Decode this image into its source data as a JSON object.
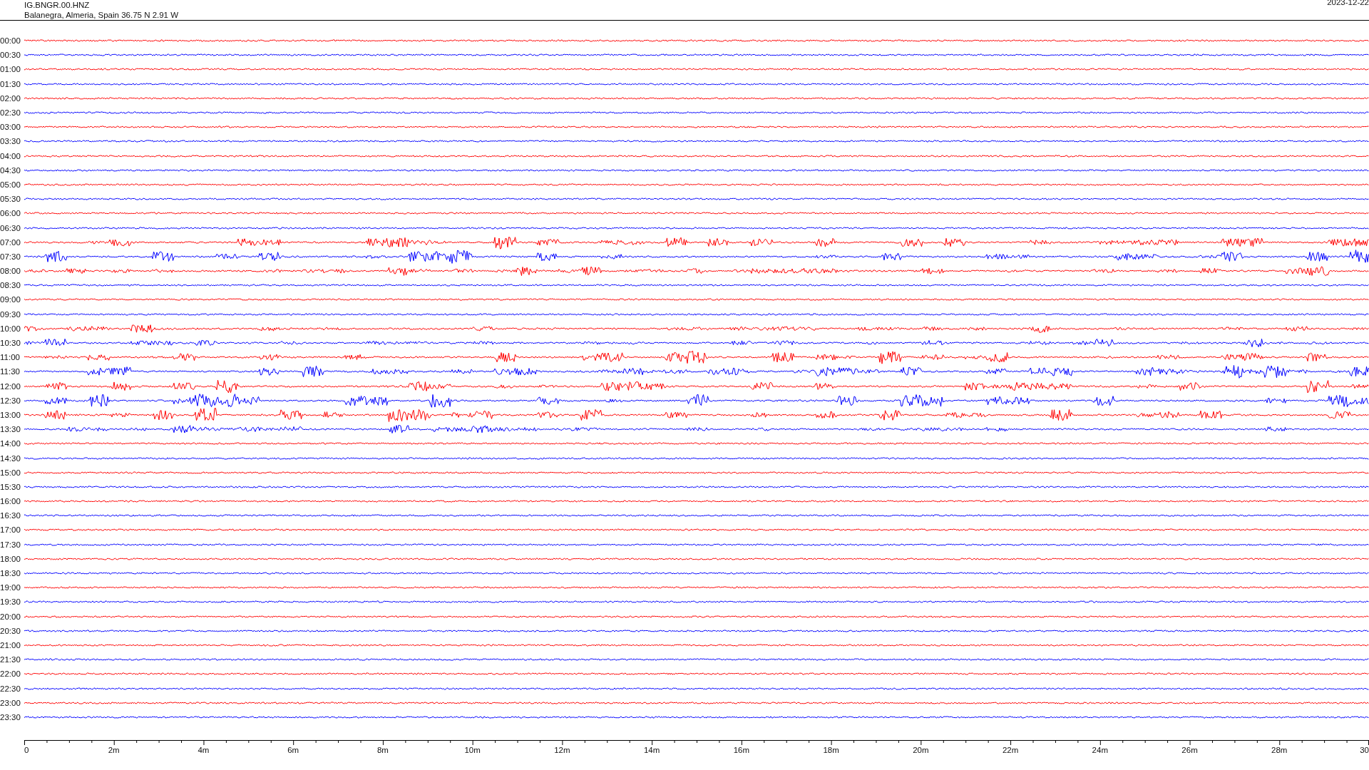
{
  "header": {
    "station": "IG.BNGR.00.HNZ",
    "location": "Balanegra, Almeria, Spain  36.75 N 2.91 W",
    "date": "2023-12-22"
  },
  "rows": [
    {
      "time": "00:00",
      "color": "#ff0000"
    },
    {
      "time": "00:30",
      "color": "#0000ff"
    },
    {
      "time": "01:00",
      "color": "#ff0000"
    },
    {
      "time": "01:30",
      "color": "#0000ff"
    },
    {
      "time": "02:00",
      "color": "#ff0000"
    },
    {
      "time": "02:30",
      "color": "#0000ff"
    },
    {
      "time": "03:00",
      "color": "#ff0000"
    },
    {
      "time": "03:30",
      "color": "#0000ff"
    },
    {
      "time": "04:00",
      "color": "#ff0000"
    },
    {
      "time": "04:30",
      "color": "#0000ff"
    },
    {
      "time": "05:00",
      "color": "#ff0000"
    },
    {
      "time": "05:30",
      "color": "#0000ff"
    },
    {
      "time": "06:00",
      "color": "#ff0000"
    },
    {
      "time": "06:30",
      "color": "#0000ff"
    },
    {
      "time": "07:00",
      "color": "#ff0000"
    },
    {
      "time": "07:30",
      "color": "#0000ff"
    },
    {
      "time": "08:00",
      "color": "#ff0000"
    },
    {
      "time": "08:30",
      "color": "#0000ff"
    },
    {
      "time": "09:00",
      "color": "#ff0000"
    },
    {
      "time": "09:30",
      "color": "#0000ff"
    },
    {
      "time": "10:00",
      "color": "#ff0000"
    },
    {
      "time": "10:30",
      "color": "#0000ff"
    },
    {
      "time": "11:00",
      "color": "#ff0000"
    },
    {
      "time": "11:30",
      "color": "#0000ff"
    },
    {
      "time": "12:00",
      "color": "#ff0000"
    },
    {
      "time": "12:30",
      "color": "#0000ff"
    },
    {
      "time": "13:00",
      "color": "#ff0000"
    },
    {
      "time": "13:30",
      "color": "#0000ff"
    },
    {
      "time": "14:00",
      "color": "#ff0000"
    },
    {
      "time": "14:30",
      "color": "#0000ff"
    },
    {
      "time": "15:00",
      "color": "#ff0000"
    },
    {
      "time": "15:30",
      "color": "#0000ff"
    },
    {
      "time": "16:00",
      "color": "#ff0000"
    },
    {
      "time": "16:30",
      "color": "#0000ff"
    },
    {
      "time": "17:00",
      "color": "#ff0000"
    },
    {
      "time": "17:30",
      "color": "#0000ff"
    },
    {
      "time": "18:00",
      "color": "#ff0000"
    },
    {
      "time": "18:30",
      "color": "#0000ff"
    },
    {
      "time": "19:00",
      "color": "#ff0000"
    },
    {
      "time": "19:30",
      "color": "#0000ff"
    },
    {
      "time": "20:00",
      "color": "#ff0000"
    },
    {
      "time": "20:30",
      "color": "#0000ff"
    },
    {
      "time": "21:00",
      "color": "#ff0000"
    },
    {
      "time": "21:30",
      "color": "#0000ff"
    },
    {
      "time": "22:00",
      "color": "#ff0000"
    },
    {
      "time": "22:30",
      "color": "#0000ff"
    },
    {
      "time": "23:00",
      "color": "#ff0000"
    },
    {
      "time": "23:30",
      "color": "#0000ff"
    }
  ],
  "x_axis": {
    "ticks": [
      "0",
      "2m",
      "4m",
      "6m",
      "8m",
      "10m",
      "12m",
      "14m",
      "16m",
      "18m",
      "20m",
      "22m",
      "24m",
      "26m",
      "28m",
      "30"
    ]
  }
}
